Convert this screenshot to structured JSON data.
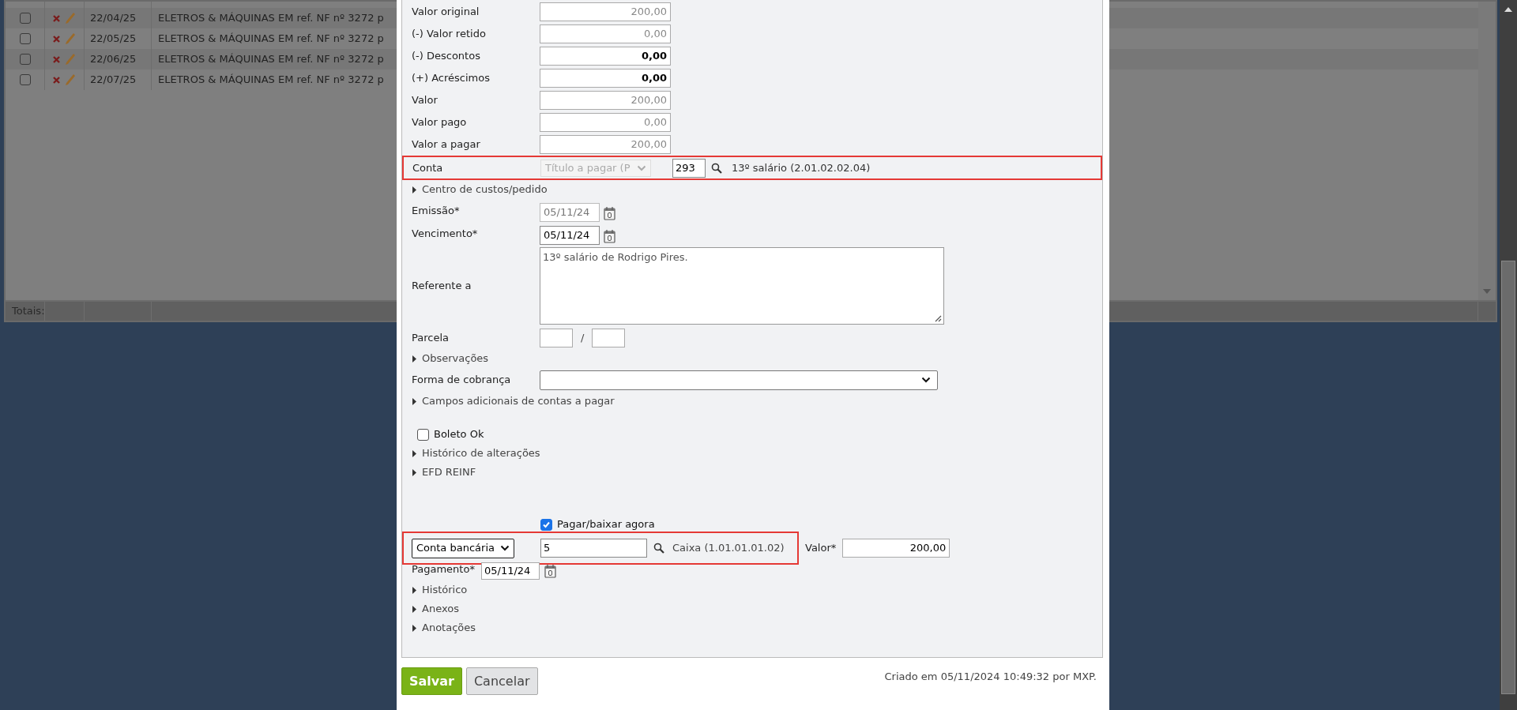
{
  "grid": {
    "rows": [
      {
        "checked": false,
        "date": "22/04/25",
        "description": "ELETROS & MÁQUINAS EM ref. NF nº 3272 p"
      },
      {
        "checked": false,
        "date": "22/05/25",
        "description": "ELETROS & MÁQUINAS EM ref. NF nº 3272 p"
      },
      {
        "checked": false,
        "date": "22/06/25",
        "description": "ELETROS & MÁQUINAS EM ref. NF nº 3272 p"
      },
      {
        "checked": false,
        "date": "22/07/25",
        "description": "ELETROS & MÁQUINAS EM ref. NF nº 3272 p"
      }
    ],
    "footer_label": "Totais:"
  },
  "form": [
    {
      "kind": "money",
      "label": "Valor original",
      "value": "200,00",
      "disabled": true
    },
    {
      "kind": "money",
      "label": "(-) Valor retido",
      "value": "0,00",
      "disabled": true
    },
    {
      "kind": "money",
      "label": "(-) Descontos",
      "value": "0,00",
      "disabled": false
    },
    {
      "kind": "money",
      "label": "(+) Acréscimos",
      "value": "0,00",
      "disabled": false
    },
    {
      "kind": "money",
      "label": "Valor",
      "value": "200,00",
      "disabled": true
    },
    {
      "kind": "money",
      "label": "Valor pago",
      "value": "0,00",
      "disabled": true
    },
    {
      "kind": "money",
      "label": "Valor a pagar",
      "value": "200,00",
      "disabled": true
    },
    {
      "kind": "account",
      "label": "Conta",
      "type": "Título a pagar (P",
      "code": "293",
      "name": "13º salário (2.01.02.02.04)",
      "highlighted": true
    },
    {
      "kind": "section",
      "label": "Centro de custos/pedido",
      "expanded": false
    },
    {
      "kind": "date",
      "label": "Emissão*",
      "value": "05/11/24",
      "disabled": true
    },
    {
      "kind": "date",
      "label": "Vencimento*",
      "value": "05/11/24",
      "disabled": false
    },
    {
      "kind": "textarea",
      "label": "Referente a",
      "value": "13º salário de Rodrigo Pires."
    },
    {
      "kind": "installment",
      "label": "Parcela",
      "separator": "/"
    },
    {
      "kind": "section",
      "label": "Observações",
      "expanded": false
    },
    {
      "kind": "select",
      "label": "Forma de cobrança"
    },
    {
      "kind": "section",
      "label": "Campos adicionais de contas a pagar",
      "expanded": false
    },
    {
      "kind": "checkbox",
      "label": "Boleto Ok",
      "checked": false
    },
    {
      "kind": "section",
      "label": "Histórico de alterações",
      "expanded": false
    },
    {
      "kind": "section",
      "label": "EFD REINF",
      "expanded": false
    }
  ],
  "payment": {
    "pay_now": {
      "label": "Pagar/baixar agora",
      "checked": true
    },
    "account_type": "Conta bancária",
    "account_code": "5",
    "account_name": "Caixa (1.01.01.01.02)",
    "highlighted": true,
    "amount_label": "Valor*",
    "amount": "200,00",
    "date_label": "Pagamento*",
    "date": "05/11/24"
  },
  "sections_after": [
    {
      "label": "Histórico",
      "expanded": false
    },
    {
      "label": "Anexos",
      "expanded": false
    },
    {
      "label": "Anotações",
      "expanded": false
    }
  ],
  "buttons": [
    {
      "kind": "primary",
      "label": "Salvar"
    },
    {
      "kind": "secondary",
      "label": "Cancelar"
    }
  ],
  "created_note": "Criado em 05/11/2024 10:49:32 por MXP."
}
